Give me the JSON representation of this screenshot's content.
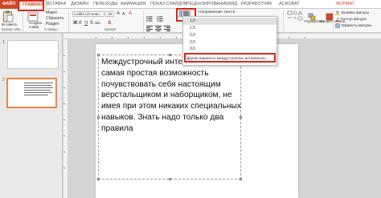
{
  "tabs": {
    "file": "ФАЙЛ",
    "home": "ГЛАВНАЯ",
    "insert": "ВСТАВКА",
    "design": "ДИЗАЙН",
    "transitions": "ПЕРЕХОДЫ",
    "animations": "АНИМАЦИЯ",
    "slideshow": "ПОКАЗ СЛАЙДОВ",
    "review": "РЕЦЕНЗИРОВАНИЕ",
    "view": "ВИД",
    "developer": "РАЗРАБОТЧИК",
    "acrobat": "ACROBAT",
    "format": "ФОРМАТ"
  },
  "ribbon": {
    "paste_label": "Вставить",
    "clipboard_group": "Буфер обм...",
    "layout_label": "Макет",
    "reset_label": "Сбросить",
    "section_label": "Раздел",
    "create_slide_label": "Создать слайд",
    "slides_group": "Слайды",
    "font_name": "Calibri (Основн...",
    "font_size": "18",
    "font_group": "Шрифт",
    "text_direction_label": "Направление текста",
    "arrange_label": "Упорядочить",
    "quick_styles_label": "Экспресс-стили",
    "shape_fill_label": "Заливка фигуры",
    "shape_outline_label": "Контур фигуры",
    "shape_effects_label": "Эффекты фигуры",
    "bold": "Ж",
    "italic": "К",
    "underline": "Ч",
    "strike": "S",
    "spacing": "abc"
  },
  "colors": {
    "accent": "#d24726",
    "highlight": "#d9261c",
    "selected_thumb": "#e8874b",
    "fill_swatch": "#f0c000",
    "outline_swatch": "#d24726"
  },
  "line_spacing_menu": {
    "options": [
      "1,0",
      "1,5",
      "2,0",
      "2,5",
      "3,0"
    ],
    "selected": "1,0",
    "more_label": "Другие варианты междустрочных интервалов..."
  },
  "slides_panel": {
    "slides": [
      {
        "number": "1",
        "selected": false
      },
      {
        "number": "2",
        "selected": true
      }
    ]
  },
  "slide": {
    "body_text": "Междустрочный интервал - это самая простая возможность почувствовать себя настоящим верстальщиком и наборщиком, не имея при этом никаких специальных навыков. Знать надо только два правила"
  },
  "icons": {
    "line_spacing": "line-spacing-icon",
    "paste": "clipboard-icon",
    "new_slide": "new-slide-icon"
  }
}
